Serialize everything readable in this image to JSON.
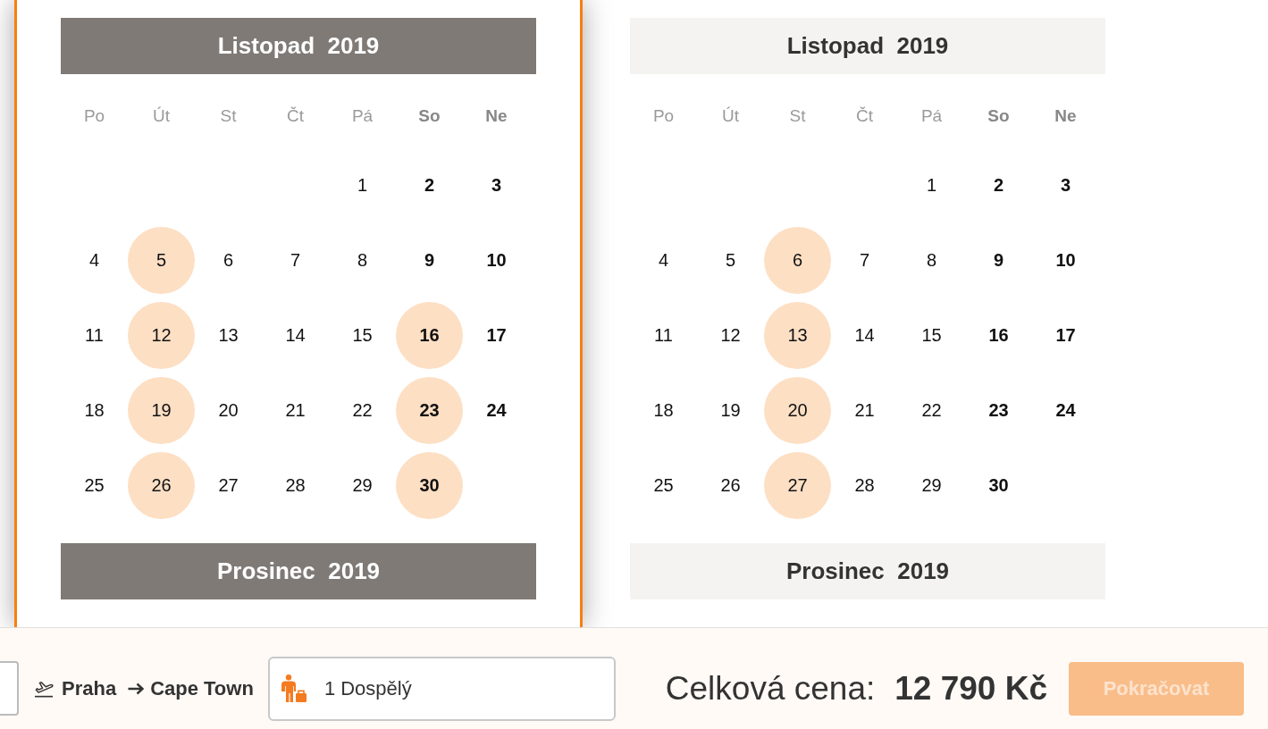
{
  "calendars": [
    {
      "active": true,
      "months": [
        {
          "title": "Listopad  2019",
          "weekdays": [
            {
              "label": "Po",
              "weekend": false
            },
            {
              "label": "Út",
              "weekend": false
            },
            {
              "label": "St",
              "weekend": false
            },
            {
              "label": "Čt",
              "weekend": false
            },
            {
              "label": "Pá",
              "weekend": false
            },
            {
              "label": "So",
              "weekend": true
            },
            {
              "label": "Ne",
              "weekend": true
            }
          ],
          "weeks": [
            {
              "days": [
                {
                  "label": "1",
                  "weekend": false,
                  "available": false
                },
                {
                  "label": "2",
                  "weekend": true,
                  "available": false
                },
                {
                  "label": "3",
                  "weekend": true,
                  "available": false
                }
              ]
            },
            {
              "days": [
                {
                  "label": "4",
                  "weekend": false,
                  "available": false
                },
                {
                  "label": "5",
                  "weekend": false,
                  "available": true
                },
                {
                  "label": "6",
                  "weekend": false,
                  "available": false
                },
                {
                  "label": "7",
                  "weekend": false,
                  "available": false
                },
                {
                  "label": "8",
                  "weekend": false,
                  "available": false
                },
                {
                  "label": "9",
                  "weekend": true,
                  "available": false
                },
                {
                  "label": "10",
                  "weekend": true,
                  "available": false
                }
              ]
            },
            {
              "days": [
                {
                  "label": "11",
                  "weekend": false,
                  "available": false
                },
                {
                  "label": "12",
                  "weekend": false,
                  "available": true
                },
                {
                  "label": "13",
                  "weekend": false,
                  "available": false
                },
                {
                  "label": "14",
                  "weekend": false,
                  "available": false
                },
                {
                  "label": "15",
                  "weekend": false,
                  "available": false
                },
                {
                  "label": "16",
                  "weekend": true,
                  "available": true
                },
                {
                  "label": "17",
                  "weekend": true,
                  "available": false
                }
              ]
            },
            {
              "days": [
                {
                  "label": "18",
                  "weekend": false,
                  "available": false
                },
                {
                  "label": "19",
                  "weekend": false,
                  "available": true
                },
                {
                  "label": "20",
                  "weekend": false,
                  "available": false
                },
                {
                  "label": "21",
                  "weekend": false,
                  "available": false
                },
                {
                  "label": "22",
                  "weekend": false,
                  "available": false
                },
                {
                  "label": "23",
                  "weekend": true,
                  "available": true
                },
                {
                  "label": "24",
                  "weekend": true,
                  "available": false
                }
              ]
            },
            {
              "days": [
                {
                  "label": "25",
                  "weekend": false,
                  "available": false
                },
                {
                  "label": "26",
                  "weekend": false,
                  "available": true
                },
                {
                  "label": "27",
                  "weekend": false,
                  "available": false
                },
                {
                  "label": "28",
                  "weekend": false,
                  "available": false
                },
                {
                  "label": "29",
                  "weekend": false,
                  "available": false
                },
                {
                  "label": "30",
                  "weekend": true,
                  "available": true
                }
              ]
            }
          ]
        },
        {
          "title": "Prosinec  2019"
        }
      ]
    },
    {
      "active": false,
      "months": [
        {
          "title": "Listopad  2019",
          "weekdays": [
            {
              "label": "Po",
              "weekend": false
            },
            {
              "label": "Út",
              "weekend": false
            },
            {
              "label": "St",
              "weekend": false
            },
            {
              "label": "Čt",
              "weekend": false
            },
            {
              "label": "Pá",
              "weekend": false
            },
            {
              "label": "So",
              "weekend": true
            },
            {
              "label": "Ne",
              "weekend": true
            }
          ],
          "weeks": [
            {
              "days": [
                {
                  "label": "1",
                  "weekend": false,
                  "available": false
                },
                {
                  "label": "2",
                  "weekend": true,
                  "available": false
                },
                {
                  "label": "3",
                  "weekend": true,
                  "available": false
                }
              ]
            },
            {
              "days": [
                {
                  "label": "4",
                  "weekend": false,
                  "available": false
                },
                {
                  "label": "5",
                  "weekend": false,
                  "available": false
                },
                {
                  "label": "6",
                  "weekend": false,
                  "available": true
                },
                {
                  "label": "7",
                  "weekend": false,
                  "available": false
                },
                {
                  "label": "8",
                  "weekend": false,
                  "available": false
                },
                {
                  "label": "9",
                  "weekend": true,
                  "available": false
                },
                {
                  "label": "10",
                  "weekend": true,
                  "available": false
                }
              ]
            },
            {
              "days": [
                {
                  "label": "11",
                  "weekend": false,
                  "available": false
                },
                {
                  "label": "12",
                  "weekend": false,
                  "available": false
                },
                {
                  "label": "13",
                  "weekend": false,
                  "available": true
                },
                {
                  "label": "14",
                  "weekend": false,
                  "available": false
                },
                {
                  "label": "15",
                  "weekend": false,
                  "available": false
                },
                {
                  "label": "16",
                  "weekend": true,
                  "available": false
                },
                {
                  "label": "17",
                  "weekend": true,
                  "available": false
                }
              ]
            },
            {
              "days": [
                {
                  "label": "18",
                  "weekend": false,
                  "available": false
                },
                {
                  "label": "19",
                  "weekend": false,
                  "available": false
                },
                {
                  "label": "20",
                  "weekend": false,
                  "available": true
                },
                {
                  "label": "21",
                  "weekend": false,
                  "available": false
                },
                {
                  "label": "22",
                  "weekend": false,
                  "available": false
                },
                {
                  "label": "23",
                  "weekend": true,
                  "available": false
                },
                {
                  "label": "24",
                  "weekend": true,
                  "available": false
                }
              ]
            },
            {
              "days": [
                {
                  "label": "25",
                  "weekend": false,
                  "available": false
                },
                {
                  "label": "26",
                  "weekend": false,
                  "available": false
                },
                {
                  "label": "27",
                  "weekend": false,
                  "available": true
                },
                {
                  "label": "28",
                  "weekend": false,
                  "available": false
                },
                {
                  "label": "29",
                  "weekend": false,
                  "available": false
                },
                {
                  "label": "30",
                  "weekend": true,
                  "available": false
                }
              ]
            }
          ]
        },
        {
          "title": "Prosinec  2019"
        }
      ]
    }
  ],
  "booking_bar": {
    "route": {
      "from": "Praha",
      "to": "Cape Town"
    },
    "passengers": {
      "value": "1 Dospělý"
    },
    "total": {
      "label": "Celková cena:",
      "price": "12 790 Kč"
    },
    "continue_button": {
      "label": "Pokračovat",
      "disabled": true
    }
  }
}
